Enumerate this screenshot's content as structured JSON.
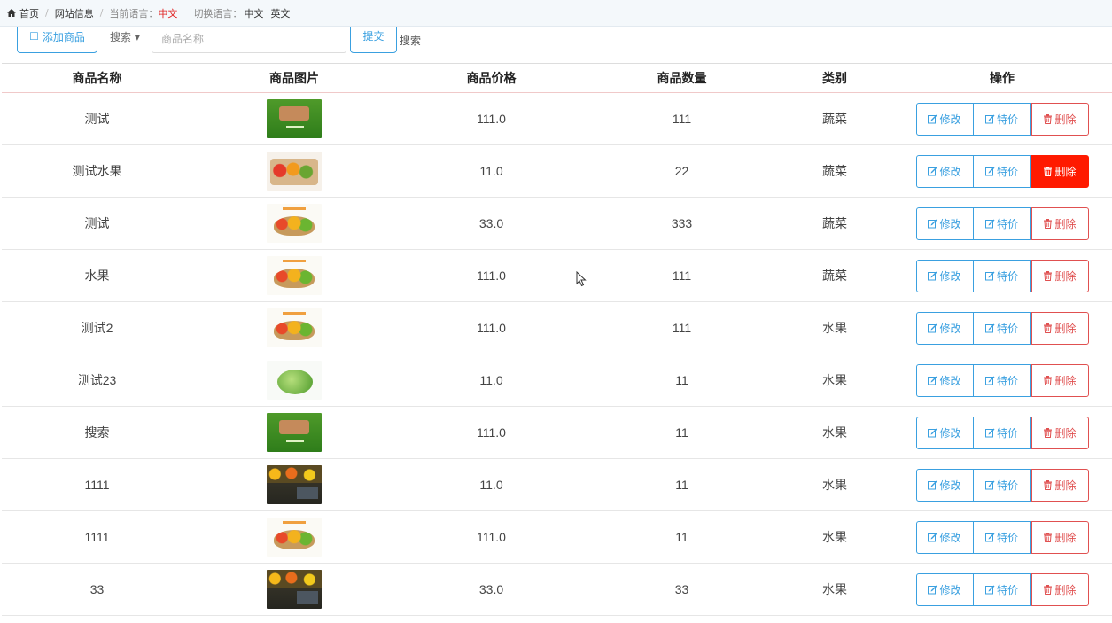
{
  "breadcrumb": {
    "home": "首页",
    "site_info": "网站信息",
    "current_lang_label": "当前语言：",
    "current_lang_value": "中文",
    "switch_label": "切换语言：",
    "switch_zh": "中文",
    "switch_en": "英文"
  },
  "toolbar": {
    "add_label": "添加商品",
    "search_dropdown": "搜索",
    "search_placeholder": "商品名称",
    "submit_label": "提交",
    "search_text": "搜索"
  },
  "table": {
    "headers": [
      "商品名称",
      "商品图片",
      "商品价格",
      "商品数量",
      "类别",
      "操作"
    ],
    "rows": [
      {
        "name": "测试",
        "image": "green",
        "price": "111.0",
        "qty": "111",
        "category": "蔬菜"
      },
      {
        "name": "测试水果",
        "image": "box",
        "price": "11.0",
        "qty": "22",
        "category": "蔬菜"
      },
      {
        "name": "测试",
        "image": "basket",
        "price": "33.0",
        "qty": "333",
        "category": "蔬菜"
      },
      {
        "name": "水果",
        "image": "basket",
        "price": "111.0",
        "qty": "111",
        "category": "蔬菜"
      },
      {
        "name": "测试2",
        "image": "basket",
        "price": "111.0",
        "qty": "111",
        "category": "水果"
      },
      {
        "name": "测试23",
        "image": "lettuce",
        "price": "11.0",
        "qty": "11",
        "category": "水果"
      },
      {
        "name": "搜索",
        "image": "green",
        "price": "111.0",
        "qty": "11",
        "category": "水果"
      },
      {
        "name": "1111",
        "image": "market",
        "price": "11.0",
        "qty": "11",
        "category": "水果"
      },
      {
        "name": "1111",
        "image": "basket",
        "price": "111.0",
        "qty": "11",
        "category": "水果"
      },
      {
        "name": "33",
        "image": "market",
        "price": "33.0",
        "qty": "33",
        "category": "水果"
      }
    ],
    "ops": {
      "edit": "修改",
      "special": "特价",
      "delete": "删除"
    },
    "active_delete_row": 1
  },
  "colors": {
    "primary": "#3aa0e0",
    "danger": "#e05050",
    "danger_active": "#ff1a00"
  }
}
